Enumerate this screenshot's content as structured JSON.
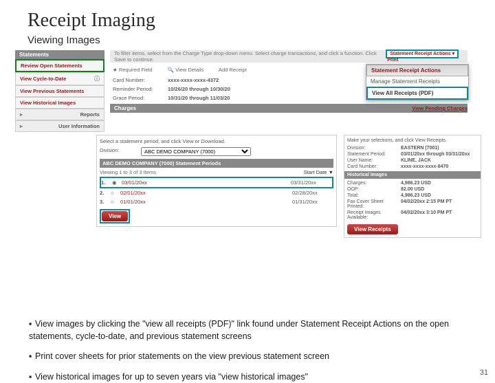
{
  "title": "Receipt Imaging",
  "subtitle": "Viewing Images",
  "sidebar": {
    "header": "Statements",
    "review_open": "Review Open Statements",
    "cycle": "View Cycle-to-Date",
    "prev": "View Previous Statements",
    "hist": "View Historical Images",
    "reports": "Reports",
    "userinfo": "User Information"
  },
  "main": {
    "filter_text": "To filter items, select from the Charge Type drop-down menu. Select charge transactions, and click a function. Click Save to continue.",
    "actions_badge": "Statement Receipt Actions",
    "print": "Print",
    "toolbar": {
      "required": "Required Field",
      "details": "View Details",
      "add": "Add Receipt"
    },
    "fields": {
      "card_lbl": "Card Number:",
      "card_val": "xxxx-xxxx-xxxx-4372",
      "rem_lbl": "Reminder Period:",
      "rem_val": "10/26/20   through 10/30/20",
      "grace_lbl": "Grace Period:",
      "grace_val": "10/31/20   through 11/03/20"
    },
    "charges_hdr": "Charges",
    "dropdown": {
      "header": "Statement Receipt Actions",
      "item1": "Manage Statement Receipts",
      "item2": "View All Receipts (PDF)"
    },
    "pending": "View Pending Charges"
  },
  "panel2": {
    "inst": "Select a statement period, and click View or Download.",
    "div_lbl": "Division:",
    "div_val": "ABC DEMO COMPANY (7000)",
    "header": "ABC DEMO COMPANY (7000) Statement Periods",
    "viewing": "Viewing 1 to 3 of 3 Items",
    "startdate": "Start Date ▼",
    "rows": [
      {
        "n": "1.",
        "d1": "03/01/20xx",
        "d2": "03/31/20xx"
      },
      {
        "n": "2.",
        "d1": "02/01/20xx",
        "d2": "02/28/20xx"
      },
      {
        "n": "3.",
        "d1": "01/01/20xx",
        "d2": "01/31/20xx"
      }
    ],
    "view": "View"
  },
  "panel3": {
    "inst": "Make your selections, and click View Receipts.",
    "division": {
      "k": "Division:",
      "v": "EASTERN (7001)"
    },
    "period": {
      "k": "Statement Period:",
      "v": "03/01/20xx through 03/31/20xx"
    },
    "user": {
      "k": "User Name:",
      "v": "KLINE, JACK"
    },
    "card": {
      "k": "Card Number:",
      "v": "xxxx-xxxx-xxxx-8470"
    },
    "hist_hdr": "Historical Images",
    "charges": {
      "k": "Charges:",
      "v": "4,986.23 USD"
    },
    "oop": {
      "k": "OOP:",
      "v": "82.00 USD"
    },
    "total": {
      "k": "Total:",
      "v": "4,986.23 USD"
    },
    "fax": {
      "k": "Fax Cover Sheet Printed:",
      "v": "04/02/20xx 2:15 PM PT"
    },
    "avail": {
      "k": "Receipt Images Available:",
      "v": "04/02/20xx 3:10 PM PT"
    },
    "view": "View Receipts"
  },
  "bullets": {
    "b1": "View images by clicking the \"view all receipts (PDF)\" link found under Statement Receipt Actions on the open   statements, cycle-to-date, and previous statement screens",
    "b2": "Print cover sheets for prior statements on the view previous statement screen",
    "b3": "View historical images for up to seven years via \"view historical images\""
  },
  "pagenum": "31"
}
